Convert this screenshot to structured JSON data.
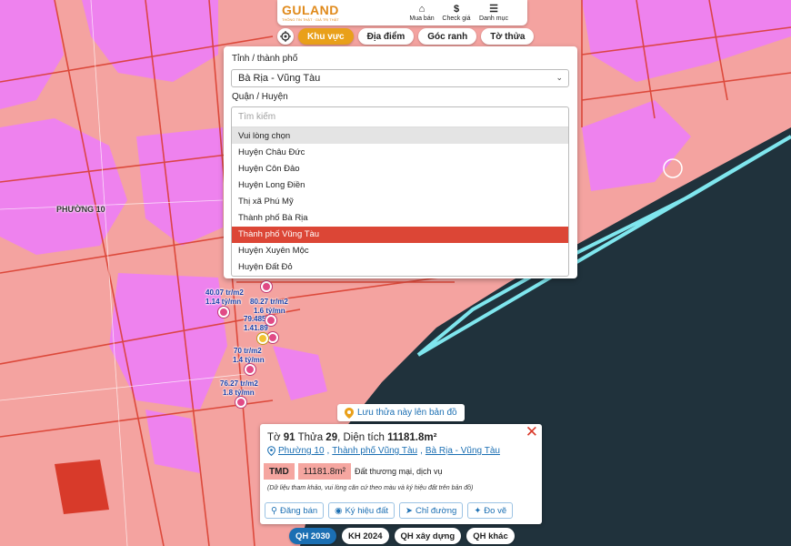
{
  "header": {
    "logo_text": "GULAND",
    "logo_sub": "THÔNG TIN THẬT · GIÁ TRỊ THẬT",
    "buttons": [
      {
        "label": "Mua bán",
        "icon": "house-icon"
      },
      {
        "label": "Check giá",
        "icon": "dollar-icon"
      },
      {
        "label": "Danh mục",
        "icon": "menu-icon"
      }
    ]
  },
  "tabs": [
    {
      "label": "Khu vực",
      "active": true
    },
    {
      "label": "Địa điểm",
      "active": false
    },
    {
      "label": "Góc ranh",
      "active": false
    },
    {
      "label": "Tờ thửa",
      "active": false
    }
  ],
  "filter": {
    "province_label": "Tỉnh / thành phố",
    "province_value": "Bà Rịa - Vũng Tàu",
    "district_label": "Quận / Huyện",
    "district_search_placeholder": "Tìm kiếm",
    "district_options": [
      "Vui lòng chọn",
      "Huyện Châu Đức",
      "Huyện Côn Đảo",
      "Huyện Long Điền",
      "Thị xã Phú Mỹ",
      "Thành phố Bà Rịa",
      "Thành phố Vũng Tàu",
      "Huyện Xuyên Mộc",
      "Huyện Đất Đỏ"
    ],
    "selected_index": 6
  },
  "map": {
    "place_label": "PHƯỜNG 10",
    "price_labels": [
      "40.07 tr/m2",
      "1.14 tỷ/mn",
      "80.27 tr/m2",
      "1.6 tỷ/mn",
      "79.485",
      "1.41.89",
      "70 tr/m2",
      "1.4 tỷ/mn",
      "76.27 tr/m2",
      "1.8 tỷ/mn"
    ]
  },
  "save_button": "Lưu thửa này lên bản đồ",
  "parcel": {
    "title_prefix": "Tờ",
    "sheet": "91",
    "plot_prefix": "Thửa",
    "plot": "29",
    "area_prefix": ", Diện tích",
    "area": "11181.8m²",
    "address": [
      "Phường 10",
      "Thành phố Vũng Tàu",
      "Bà Rịa - Vũng Tàu"
    ],
    "land_code": "TMD",
    "land_area": "11181.8m²",
    "land_desc": "Đất thương mại, dịch vụ",
    "note": "(Dữ liệu tham khảo, vui lòng căn cứ theo màu và ký hiệu đất trên bản đồ)",
    "actions": [
      "Đăng bán",
      "Ký hiệu đất",
      "Chỉ đường",
      "Đo vẽ"
    ]
  },
  "layers": [
    {
      "label": "QH 2030",
      "active": true
    },
    {
      "label": "KH 2024",
      "active": false
    },
    {
      "label": "QH xây dựng",
      "active": false
    },
    {
      "label": "QH khác",
      "active": false
    }
  ],
  "colors": {
    "accent": "#e9a01a",
    "selected": "#dc4636",
    "link": "#1b6fb3",
    "land_pink": "#f4a3a0",
    "residential_magenta": "#ee82ee",
    "sea": "#20323c"
  }
}
